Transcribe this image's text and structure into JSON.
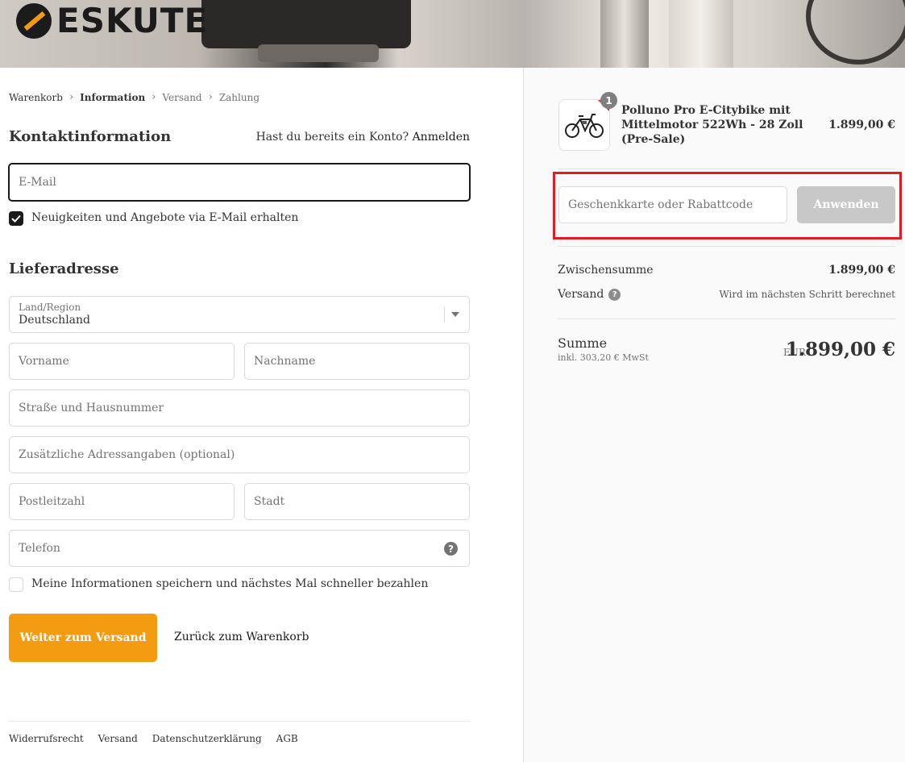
{
  "brand": {
    "logo_text": "ESKUTE"
  },
  "breadcrumb": {
    "items": [
      "Warenkorb",
      "Information",
      "Versand",
      "Zahlung"
    ]
  },
  "contact": {
    "heading": "Kontaktinformation",
    "login_prompt": "Hast du bereits ein Konto?",
    "login_link": "Anmelden",
    "email_placeholder": "E-Mail",
    "newsletter_label": "Neuigkeiten und Angebote via E-Mail erhalten",
    "newsletter_checked": true
  },
  "shipping": {
    "heading": "Lieferadresse",
    "country_label": "Land/Region",
    "country_value": "Deutschland",
    "first_name": "Vorname",
    "last_name": "Nachname",
    "street": "Straße und Hausnummer",
    "address2": "Zusätzliche Adressangaben (optional)",
    "postal_code": "Postleitzahl",
    "city": "Stadt",
    "phone": "Telefon",
    "save_info_label": "Meine Informationen speichern und nächstes Mal schneller bezahlen",
    "save_info_checked": false
  },
  "actions": {
    "continue_label": "Weiter zum Versand",
    "back_label": "Zurück zum Warenkorb"
  },
  "footer": {
    "links": [
      "Widerrufsrecht",
      "Versand",
      "Datenschutzerklärung",
      "AGB"
    ]
  },
  "summary": {
    "product": {
      "quantity": "1",
      "name": "Polluno Pro E-Citybike mit Mittelmotor 522Wh - 28 Zoll (Pre-Sale)",
      "price": "1.899,00 €",
      "image_icon": "e-bike-icon"
    },
    "discount_placeholder": "Geschenkkarte oder Rabattcode",
    "apply_label": "Anwenden",
    "subtotal_label": "Zwischensumme",
    "subtotal_value": "1.899,00 €",
    "shipping_label": "Versand",
    "shipping_value": "Wird im nächsten Schritt berechnet",
    "total_label": "Summe",
    "tax_note": "inkl. 303,20 € MwSt",
    "currency": "EUR",
    "total_value": "1.899,00 €"
  },
  "colors": {
    "accent": "#f39c12",
    "highlight": "#e31b23",
    "text": "#333333"
  }
}
